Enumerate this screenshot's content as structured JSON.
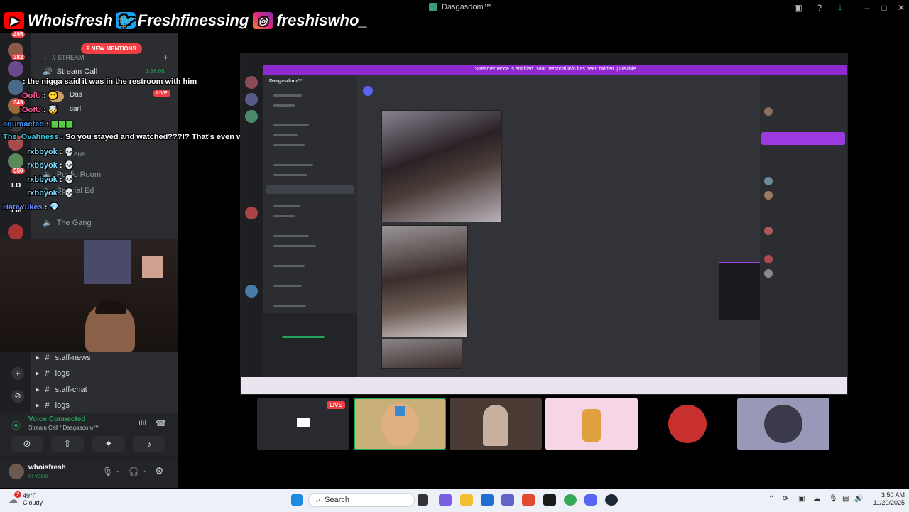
{
  "window": {
    "title": "Dasgasdom™"
  },
  "banner": {
    "youtube": "Whoisfresh",
    "twitter": "Freshfinessing",
    "instagram": "freshiswho_"
  },
  "sidebar": {
    "new_mentions": "9 NEW MENTIONS",
    "stream_category": "// STREAM",
    "stream_call": {
      "label": "Stream Call",
      "time": "1:56:05",
      "live": "LIVE"
    },
    "user_das": "Das",
    "user_carl": "carl",
    "user_zeus": "Zeus",
    "public_room": "Public Room",
    "special_ed": "Special Ed",
    "the_gang": "The Gang",
    "badges": [
      "495",
      "382",
      "349",
      "550"
    ],
    "server_initials": [
      "LD",
      "FM"
    ]
  },
  "chat": [
    {
      "user": "",
      "text": "the nigga said it was in the restroom with him"
    },
    {
      "user": "iOofU",
      "text": ""
    },
    {
      "user": "iOofU",
      "text": ""
    },
    {
      "user": "equmacted",
      "text": ""
    },
    {
      "user": "The_Ovahness",
      "text": "So you stayed and watched???!? That's even worse. Lol"
    },
    {
      "user": "rxbbyok",
      "text": ""
    },
    {
      "user": "rxbbyok",
      "text": ""
    },
    {
      "user": "rxbbyok",
      "text": ""
    },
    {
      "user": "rxbbyok",
      "text": ""
    },
    {
      "user": "HateYukes",
      "text": ""
    }
  ],
  "lower_channels": [
    {
      "label": "staff-news"
    },
    {
      "label": "logs"
    },
    {
      "label": "staff-chat"
    },
    {
      "label": "logs"
    }
  ],
  "voice": {
    "status": "Voice Connected",
    "location": "Stream Call / Dasgasdom™"
  },
  "user": {
    "name": "whoisfresh",
    "status": "In voice"
  },
  "stage": {
    "live_tag": "LIVE",
    "shared_notice": "Streamer Mode is enabled. Your personal info has been hidden. | Disable",
    "shared_server": "Dasgasdom™"
  },
  "taskbar": {
    "search": "Search",
    "weather_temp": "49°F",
    "weather_desc": "Cloudy",
    "weather_badge": "2",
    "time": "3:50 AM",
    "date": "11/20/2025"
  },
  "colors": {
    "discord_dark": "#1e1f22",
    "discord_mid": "#2b2d31",
    "live_red": "#f23f43",
    "voice_green": "#23a55a",
    "notice_purple": "#8f2ad1"
  }
}
